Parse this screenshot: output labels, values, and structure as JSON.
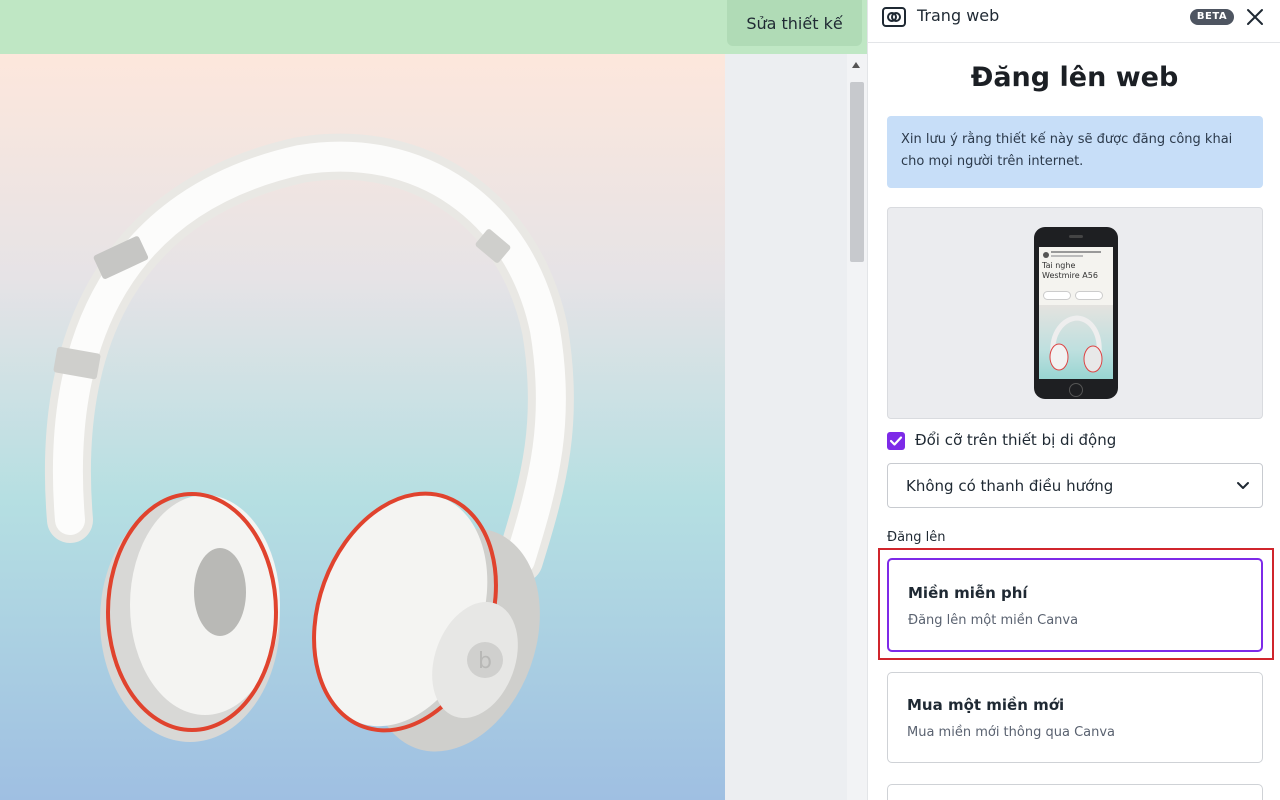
{
  "editor": {
    "edit_button_label": "Sửa thiết kế"
  },
  "phone_preview": {
    "title": "Tai nghe Westmire A56"
  },
  "panel": {
    "header_title": "Trang web",
    "beta_badge": "BETA",
    "heading": "Đăng lên web",
    "notice": "Xin lưu ý rằng thiết kế này sẽ được đăng công khai cho mọi người trên internet.",
    "resize_checkbox_label": "Đổi cỡ trên thiết bị di động",
    "resize_checked": true,
    "navigation_select_value": "Không có thanh điều hướng",
    "publish_section_label": "Đăng lên",
    "options": [
      {
        "title": "Miền miễn phí",
        "subtitle": "Đăng lên một miền Canva",
        "selected": true
      },
      {
        "title": "Mua một miền mới",
        "subtitle": "Mua miền mới thông qua Canva",
        "selected": false
      }
    ]
  },
  "colors": {
    "accent_purple": "#7d2ae8",
    "highlight_red": "#d0252c",
    "notice_blue": "#c7def8",
    "top_strip_green": "#bfe7c4"
  }
}
